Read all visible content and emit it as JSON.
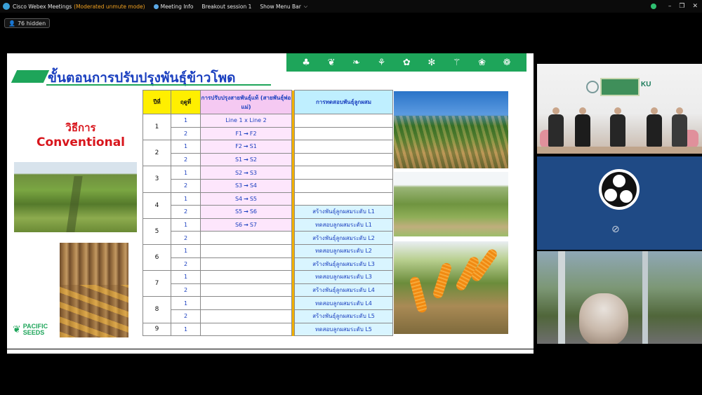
{
  "titlebar": {
    "app_title": "Cisco Webex Meetings",
    "mode": "(Moderated unmute mode)",
    "meeting_info": "Meeting Info",
    "breakout": "Breakout session 1",
    "menu_bar": "Show Menu Bar",
    "minimize": "–",
    "restore": "❐",
    "close": "✕"
  },
  "participants": {
    "hidden_label": "76 hidden"
  },
  "slide": {
    "title": "ขั้นตอนการปรับปรุงพันธุ์ข้าวโพด",
    "method_th": "วิธีการ",
    "method_en": "Conventional",
    "logo_line1": "PACIFIC",
    "logo_line2": "SEEDS",
    "table": {
      "headers": {
        "year": "ปีที่",
        "season": "ฤดูที่",
        "line_dev": "การปรับปรุงสายพันธุ์แท้ (สายพันธุ์พ่อแม่)",
        "hybrid_test": "การทดสอบพันธุ์ลูกผสม"
      },
      "years": [
        "1",
        "2",
        "3",
        "4",
        "5",
        "6",
        "7",
        "8",
        "9"
      ],
      "rows": [
        {
          "season": "1",
          "line": [
            "Line 1 x Line 2",
            "",
            ""
          ],
          "test": ""
        },
        {
          "season": "2",
          "line": [
            "F1",
            "→",
            "F2"
          ],
          "test": ""
        },
        {
          "season": "1",
          "line": [
            "F2",
            "→",
            "S1"
          ],
          "test": ""
        },
        {
          "season": "2",
          "line": [
            "S1",
            "→",
            "S2"
          ],
          "test": ""
        },
        {
          "season": "1",
          "line": [
            "S2",
            "→",
            "S3"
          ],
          "test": ""
        },
        {
          "season": "2",
          "line": [
            "S3",
            "→",
            "S4"
          ],
          "test": ""
        },
        {
          "season": "1",
          "line": [
            "S4",
            "→",
            "S5"
          ],
          "test": ""
        },
        {
          "season": "2",
          "line": [
            "S5",
            "→",
            "S6"
          ],
          "test": "สร้างพันธุ์ลูกผสมระดับ L1"
        },
        {
          "season": "1",
          "line": [
            "S6",
            "→",
            "S7"
          ],
          "test": "ทดสอบลูกผสมระดับ L1"
        },
        {
          "season": "2",
          "line": [
            "",
            "",
            ""
          ],
          "test": "สร้างพันธุ์ลูกผสมระดับ L2"
        },
        {
          "season": "1",
          "line": [
            "",
            "",
            ""
          ],
          "test": "ทดสอบลูกผสมระดับ L2"
        },
        {
          "season": "2",
          "line": [
            "",
            "",
            ""
          ],
          "test": "สร้างพันธุ์ลูกผสมระดับ L3"
        },
        {
          "season": "1",
          "line": [
            "",
            "",
            ""
          ],
          "test": "ทดสอบลูกผสมระดับ L3"
        },
        {
          "season": "2",
          "line": [
            "",
            "",
            ""
          ],
          "test": "สร้างพันธุ์ลูกผสมระดับ L4"
        },
        {
          "season": "1",
          "line": [
            "",
            "",
            ""
          ],
          "test": "ทดสอบลูกผสมระดับ L4"
        },
        {
          "season": "2",
          "line": [
            "",
            "",
            ""
          ],
          "test": "สร้างพันธุ์ลูกผสมระดับ L5"
        },
        {
          "season": "1",
          "line": [
            "",
            "",
            ""
          ],
          "test": "ทดสอบลูกผสมระดับ L5"
        }
      ]
    }
  },
  "video_tiles": {
    "stage_sign": "KU"
  },
  "colors": {
    "accent_green": "#1ea55a",
    "title_blue": "#1a3fbf",
    "method_red": "#d8151c",
    "header_yellow": "#ffef00",
    "header_pink": "#f5c9f2",
    "header_cyan": "#bfefff",
    "mode_orange": "#f0a020"
  },
  "icons": {
    "topbar": [
      "plant-icon",
      "leaf-icon",
      "corn-icon",
      "wheat-icon",
      "grain-icon",
      "flower-icon",
      "rice-icon",
      "sprout-icon",
      "pea-icon"
    ]
  }
}
